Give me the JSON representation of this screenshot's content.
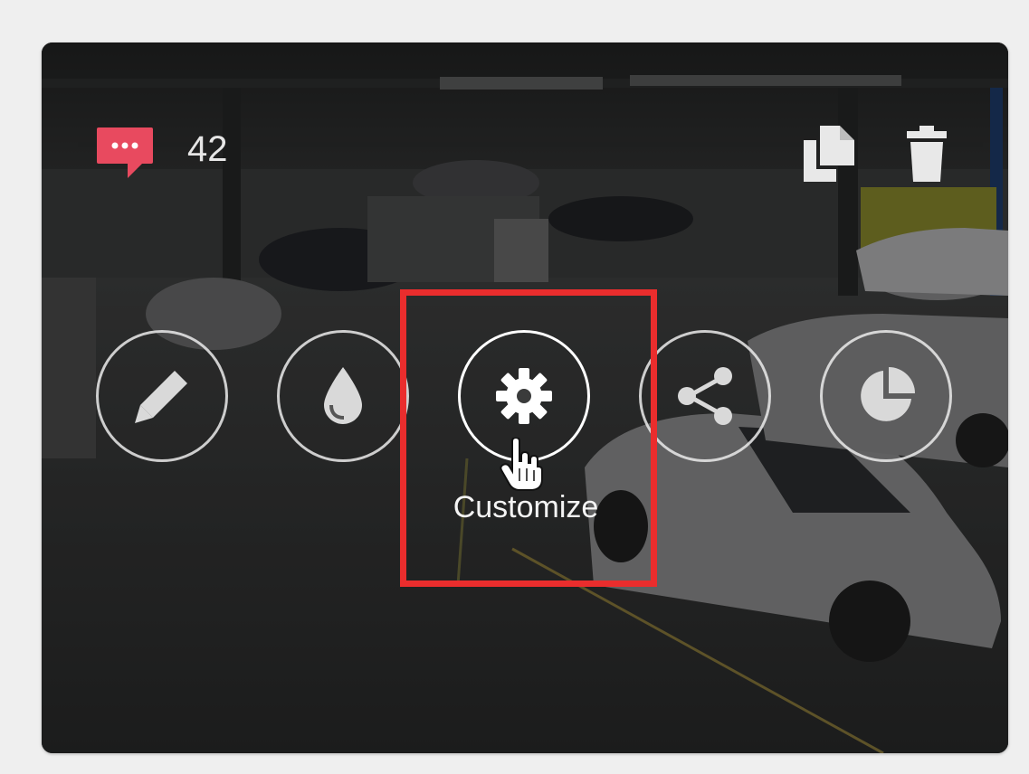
{
  "card": {
    "comment_count": "42",
    "colors": {
      "comment_badge": "#e84a5f",
      "highlight": "#ea2d2d",
      "icon": "#e8e8e8"
    },
    "top_actions": [
      {
        "icon": "copy-icon"
      },
      {
        "icon": "trash-icon"
      }
    ],
    "actions": [
      {
        "icon": "pencil-icon"
      },
      {
        "icon": "droplet-icon"
      },
      {
        "icon": "gear-icon",
        "label": "Customize",
        "hovered": true
      },
      {
        "icon": "share-icon"
      },
      {
        "icon": "pie-chart-icon"
      }
    ]
  }
}
